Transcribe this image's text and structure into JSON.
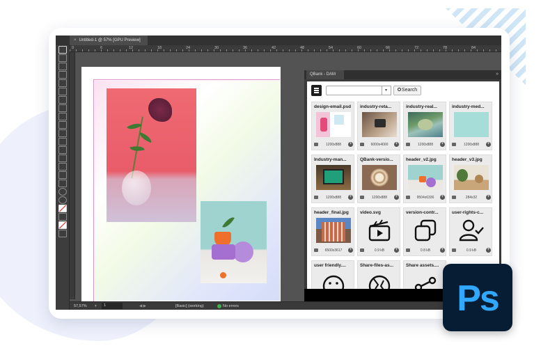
{
  "document": {
    "tab_title": "Untitled-1 @ 57% [GPU Preview]",
    "close_glyph": "×",
    "ruler_marks": [
      "0",
      "6",
      "12",
      "18",
      "24",
      "30",
      "36",
      "42",
      "48",
      "54",
      "60",
      "66",
      "72",
      "78",
      "84"
    ]
  },
  "panel": {
    "tab_label": "QBank - DAM",
    "collapse_glyph": "»",
    "search": {
      "value": "",
      "placeholder": "",
      "dropdown_glyph": "▾",
      "button_label": "Search"
    },
    "assets": [
      {
        "name": "design-email.psd",
        "dims": "1200x888",
        "thumb": "pink-room"
      },
      {
        "name": "industry-reta...",
        "dims": "6000x4000",
        "thumb": "retail-payment"
      },
      {
        "name": "industry-real...",
        "dims": "1200x888",
        "thumb": "aerial-coast"
      },
      {
        "name": "industry-med...",
        "dims": "1200x888",
        "thumb": "mint-blank"
      },
      {
        "name": "Industry-man...",
        "dims": "1200x888",
        "thumb": "factory-screen"
      },
      {
        "name": "QBank-versio...",
        "dims": "1200x888",
        "thumb": "latte-art"
      },
      {
        "name": "header_v2.jpg",
        "dims": "9504x6336",
        "thumb": "plant-shapes"
      },
      {
        "name": "header_v3.jpg",
        "dims": "284x32",
        "thumb": "plant-shelf"
      },
      {
        "name": "header_final.jpg",
        "dims": "6500x3617",
        "thumb": "city-building"
      },
      {
        "name": "video.svg",
        "dims": "0.9 kB",
        "thumb": "clapperboard-icon"
      },
      {
        "name": "version-contr...",
        "dims": "0.8 kB",
        "thumb": "copy-icon"
      },
      {
        "name": "user-rights-c...",
        "dims": "0.9 kB",
        "thumb": "user-check-icon"
      },
      {
        "name": "user friendly....",
        "dims": "",
        "thumb": "smile-icon"
      },
      {
        "name": "Share-files-as...",
        "dims": "",
        "thumb": "globe-icon"
      },
      {
        "name": "Share assets....",
        "dims": "",
        "thumb": "share-icon"
      }
    ]
  },
  "status_bar": {
    "zoom": "57,57%",
    "page": "1",
    "style": "[Basic] (working)",
    "errors": "No errors"
  },
  "badge": {
    "text": "Ps"
  },
  "colors": {
    "ps_bg": "#061d34",
    "ps_text": "#31a8ff",
    "ok": "#41b04a",
    "ui_dark": "#535353"
  }
}
